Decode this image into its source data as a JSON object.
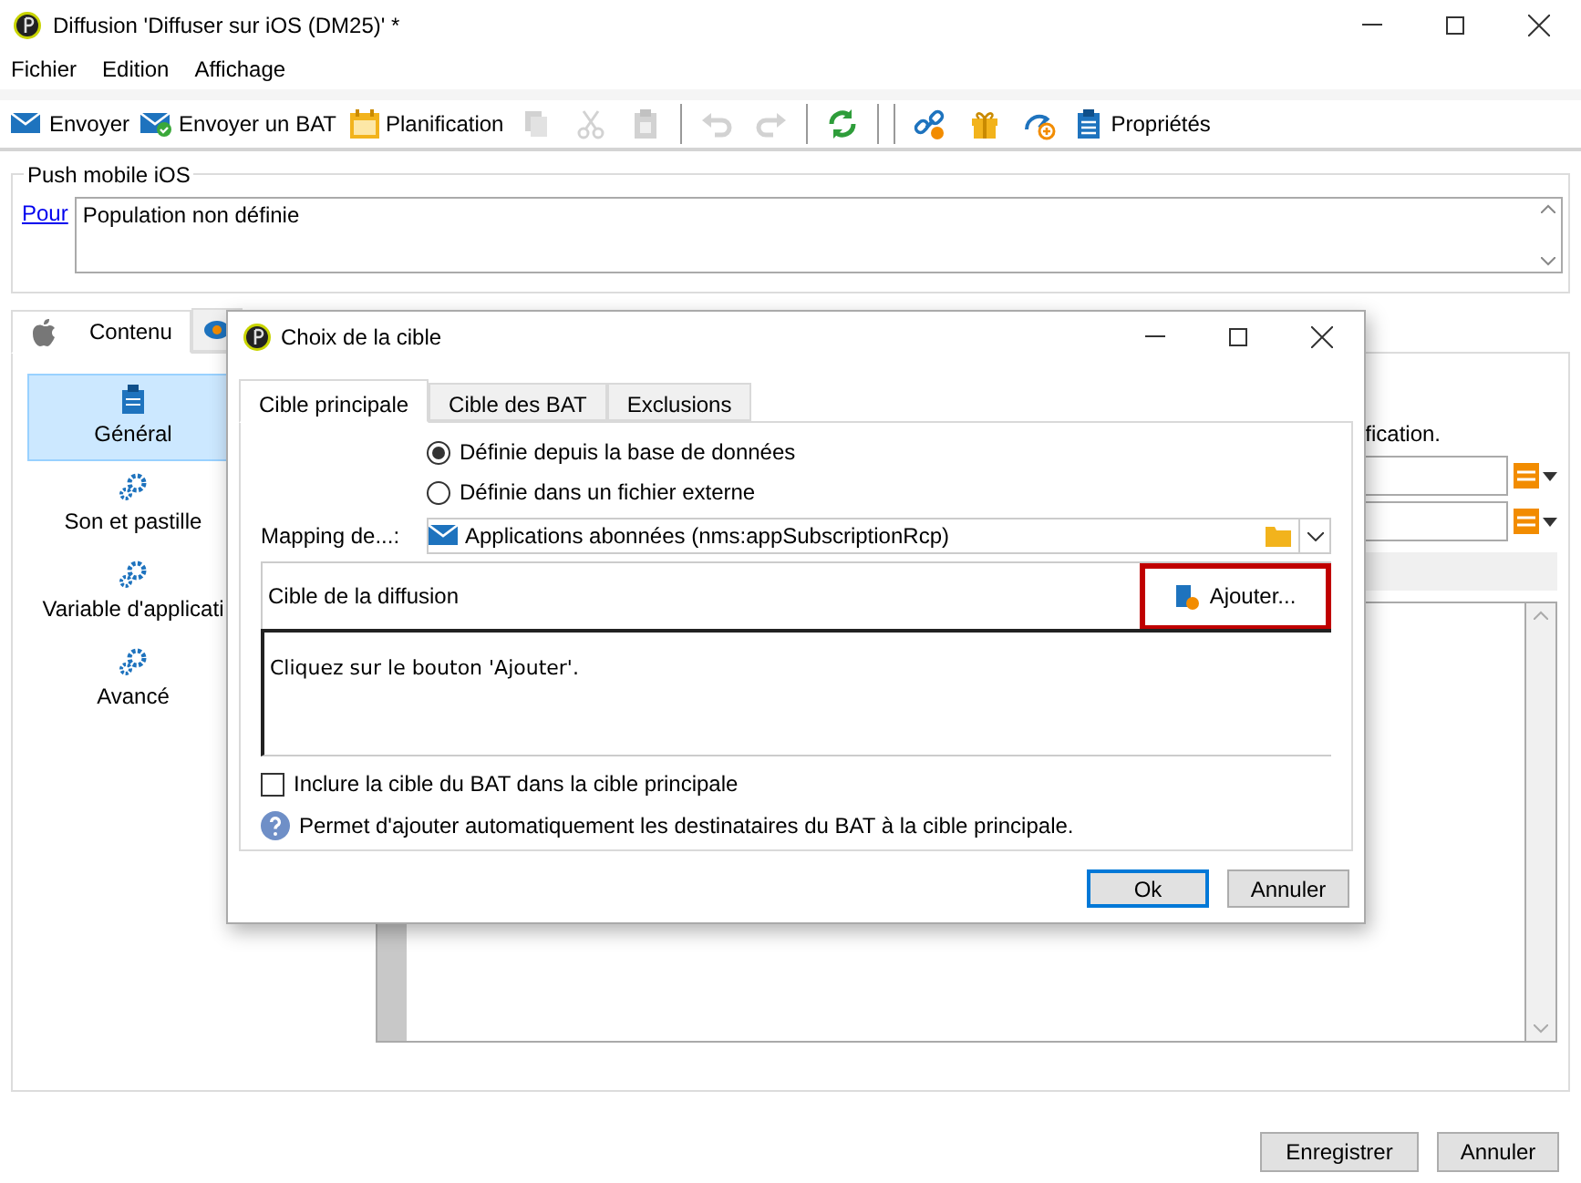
{
  "window": {
    "title": "Diffusion 'Diffuser sur iOS (DM25)' *"
  },
  "menu": [
    "Fichier",
    "Edition",
    "Affichage"
  ],
  "toolbar": [
    {
      "kind": "button",
      "label": "Envoyer",
      "disabled": false
    },
    {
      "kind": "button",
      "label": "Envoyer un BAT",
      "disabled": false
    },
    {
      "kind": "button",
      "label": "Planification",
      "disabled": false
    },
    {
      "kind": "icon",
      "disabled": true
    },
    {
      "kind": "icon",
      "disabled": true
    },
    {
      "kind": "icon",
      "disabled": true
    },
    {
      "kind": "separator"
    },
    {
      "kind": "icon",
      "disabled": true
    },
    {
      "kind": "icon",
      "disabled": true
    },
    {
      "kind": "separator"
    },
    {
      "kind": "icon",
      "disabled": false
    },
    {
      "kind": "separator"
    },
    {
      "kind": "separator"
    },
    {
      "kind": "icon",
      "disabled": false
    },
    {
      "kind": "icon",
      "disabled": false
    },
    {
      "kind": "icon",
      "disabled": false
    },
    {
      "kind": "button",
      "label": "Propriétés",
      "disabled": false
    }
  ],
  "group": {
    "legend": "Push mobile iOS",
    "link": "Pour",
    "value": "Population non définie"
  },
  "tabs": [
    {
      "label": "Contenu",
      "selected": true
    },
    {
      "selected": false
    }
  ],
  "sidebar": [
    {
      "label": "Général",
      "selected": true
    },
    {
      "label": "Son et pastille",
      "selected": false
    },
    {
      "label": "Variable d'applicati",
      "selected": false
    },
    {
      "label": "Avancé",
      "selected": false
    }
  ],
  "content": {
    "partial_text": "fication."
  },
  "footer_buttons": [
    "Enregistrer",
    "Annuler"
  ],
  "dialog": {
    "title": "Choix de la cible",
    "tabs": [
      {
        "label": "Cible principale",
        "selected": true
      },
      {
        "label": "Cible des BAT",
        "selected": false
      },
      {
        "label": "Exclusions",
        "selected": false
      }
    ],
    "radios": [
      {
        "label": "Définie depuis la base de données",
        "selected": true
      },
      {
        "label": "Définie dans un fichier externe",
        "selected": false
      }
    ],
    "mapping": {
      "label": "Mapping de...:",
      "value": "Applications abonnées (nms:appSubscriptionRcp)"
    },
    "target": {
      "title": "Cible de la diffusion",
      "add_button": "Ajouter...",
      "highlighted": true,
      "message": "Cliquez sur le bouton 'Ajouter'."
    },
    "include": {
      "label": "Inclure la cible du BAT dans la cible principale",
      "checked": false
    },
    "help": "Permet d'ajouter automatiquement les destinataires du BAT à la cible principale.",
    "buttons": [
      {
        "label": "Ok",
        "default": true
      },
      {
        "label": "Annuler",
        "default": false
      }
    ]
  }
}
